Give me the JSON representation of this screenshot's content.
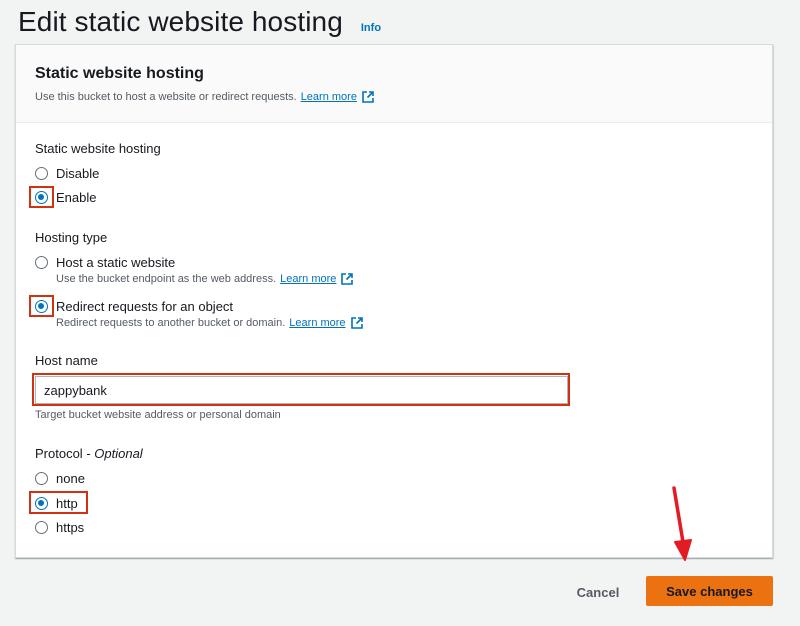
{
  "header": {
    "title": "Edit static website hosting",
    "info": "Info"
  },
  "card": {
    "title": "Static website hosting",
    "description": "Use this bucket to host a website or redirect requests.",
    "learn_more": "Learn more"
  },
  "hosting": {
    "label": "Static website hosting",
    "options": [
      "Disable",
      "Enable"
    ],
    "selected": "Enable"
  },
  "hosting_type": {
    "label": "Hosting type",
    "options": [
      {
        "label": "Host a static website",
        "description": "Use the bucket endpoint as the web address.",
        "learn_more": "Learn more"
      },
      {
        "label": "Redirect requests for an object",
        "description": "Redirect requests to another bucket or domain.",
        "learn_more": "Learn more"
      }
    ],
    "selected": "Redirect requests for an object"
  },
  "host_name": {
    "label": "Host name",
    "value": "zappybank",
    "hint": "Target bucket website address or personal domain"
  },
  "protocol": {
    "label": "Protocol",
    "optional": "Optional",
    "options": [
      "none",
      "http",
      "https"
    ],
    "selected": "http"
  },
  "actions": {
    "cancel": "Cancel",
    "save": "Save changes"
  },
  "colors": {
    "primary_button": "#ec7211",
    "link": "#0073bb",
    "highlight": "#d13212",
    "annotation_arrow": "#e31b23"
  },
  "icons": {
    "external_link": "external-link-icon",
    "annotation": "arrow-down-icon"
  }
}
